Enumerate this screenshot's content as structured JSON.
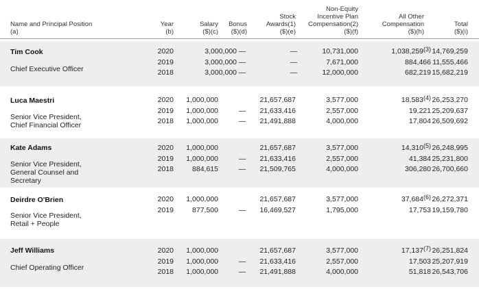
{
  "headers": {
    "name": "Name and Principal Position\n(a)",
    "year": "Year\n(b)",
    "salary": "Salary\n($)(c)",
    "bonus": "Bonus\n($)(d)",
    "stock": "Stock\nAwards(1)\n($)(e)",
    "nonequity": "Non-Equity\nIncentive Plan\nCompensation(2)\n($)(f)",
    "other": "All Other\nCompensation\n($)(h)",
    "total": "Total\n($)(i)"
  },
  "dash": "—",
  "executives": [
    {
      "name": "Tim Cook",
      "title": "Chief Executive Officer",
      "years": "2020\n2019\n2018",
      "salary": "3,000,000\n3,000,000\n3,000,000",
      "bonus": "—\n—\n—",
      "stock": "—\n—\n—",
      "nonequity": "10,731,000\n7,671,000\n12,000,000",
      "other_first": "1,038,259",
      "other_note": "(3)",
      "other_rest": "884,466\n682,219",
      "total": "14,769,259\n11,555,466\n15,682,219"
    },
    {
      "name": "Luca Maestri",
      "title": "Senior Vice President,\nChief Financial Officer",
      "years": "2020\n2019\n2018",
      "salary": "1,000,000\n1,000,000\n1,000,000",
      "bonus": "—\n—",
      "stock": "21,657,687\n21,633,416\n21,491,888",
      "nonequity": "3,577,000\n2,557,000\n4,000,000",
      "other_first": "18,583",
      "other_note": "(4)",
      "other_rest": "19,221\n17,804",
      "total": "26,253,270\n25,209,637\n26,509,692"
    },
    {
      "name": "Kate Adams",
      "title": "Senior Vice President,\nGeneral Counsel and\nSecretary",
      "years": "2020\n2019\n2018",
      "salary": "1,000,000\n1,000,000\n884,615",
      "bonus": "—\n—",
      "stock": "21,657,687\n21,633,416\n21,509,765",
      "nonequity": "3,577,000\n2,557,000\n4,000,000",
      "other_first": "14,310",
      "other_note": "(5)",
      "other_rest": "41,384\n306,280",
      "total": "26,248,995\n25,231,800\n26,700,660"
    },
    {
      "name": "Deirdre O'Brien",
      "title": "Senior Vice President,\nRetail + People",
      "years": "2020\n2019",
      "salary": "1,000,000\n877,500",
      "bonus": "—",
      "stock": "21,657,687\n16,469,527",
      "nonequity": "3,577,000\n1,795,000",
      "other_first": "37,684",
      "other_note": "(6)",
      "other_rest": "17,753",
      "total": "26,272,371\n19,159,780"
    },
    {
      "name": "Jeff Williams",
      "title": "Chief Operating Officer",
      "years": "2020\n2019\n2018",
      "salary": "1,000,000\n1,000,000\n1,000,000",
      "bonus": "—\n—",
      "stock": "21,657,687\n21,633,416\n21,491,888",
      "nonequity": "3,577,000\n2,557,000\n4,000,000",
      "other_first": "17,137",
      "other_note": "(7)",
      "other_rest": "17,503\n51,818",
      "total": "26,251,824\n25,207,919\n26,543,706"
    }
  ]
}
